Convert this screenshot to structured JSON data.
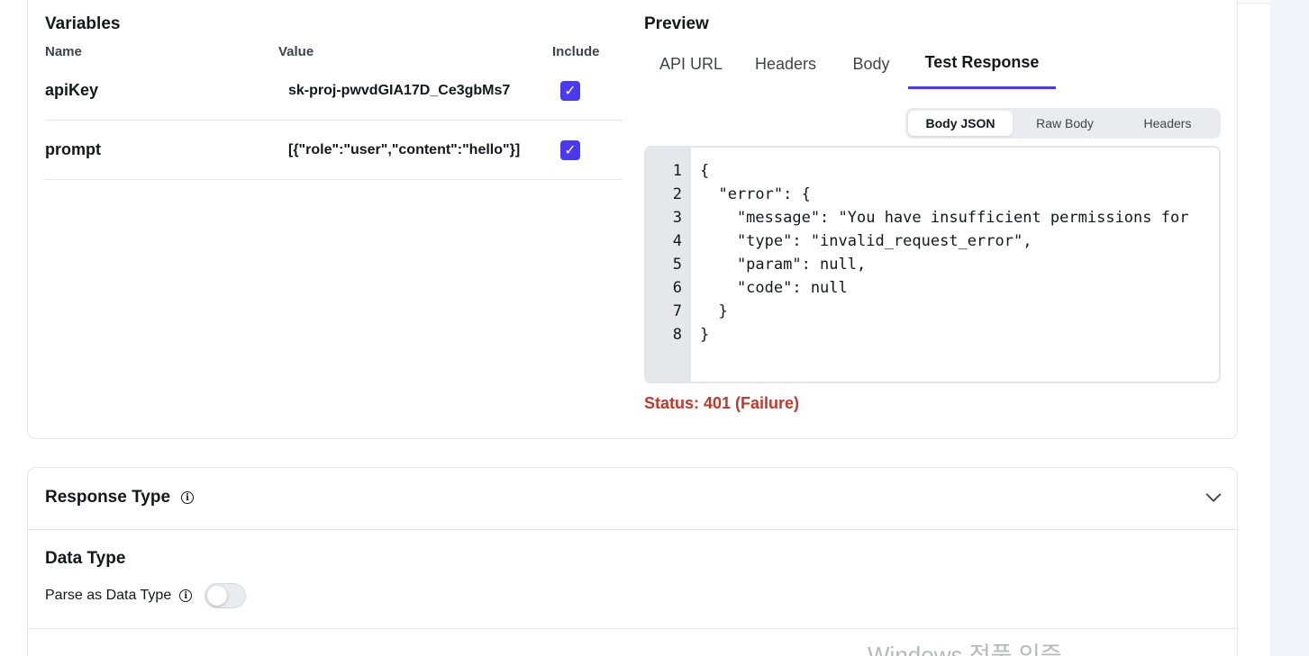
{
  "variables": {
    "title": "Variables",
    "columns": {
      "name": "Name",
      "value": "Value",
      "include": "Include"
    },
    "rows": [
      {
        "name": "apiKey",
        "value": "sk-proj-pwvdGIA17D_Ce3gbMs7",
        "include": true
      },
      {
        "name": "prompt",
        "value": "[{\"role\":\"user\",\"content\":\"hello\"}]",
        "include": true
      }
    ],
    "check_glyph": "✓"
  },
  "preview": {
    "title": "Preview",
    "tabs": [
      {
        "label": "API URL",
        "active": false
      },
      {
        "label": "Headers",
        "active": false
      },
      {
        "label": "Body",
        "active": false
      },
      {
        "label": "Test Response",
        "active": true
      }
    ],
    "subtabs": [
      {
        "label": "Body JSON",
        "active": true
      },
      {
        "label": "Raw Body",
        "active": false
      },
      {
        "label": "Headers",
        "active": false
      }
    ],
    "code_lines": [
      "{",
      "  \"error\": {",
      "    \"message\": \"You have insufficient permissions for",
      "    \"type\": \"invalid_request_error\",",
      "    \"param\": null,",
      "    \"code\": null",
      "  }",
      "}"
    ],
    "line_numbers": [
      "1",
      "2",
      "3",
      "4",
      "5",
      "6",
      "7",
      "8"
    ],
    "status": "Status:  401 (Failure)",
    "status_color": "#c0392b"
  },
  "response_type": {
    "title": "Response Type",
    "info_glyph": "i",
    "chevron": "chevron-down-icon"
  },
  "data_type": {
    "title": "Data Type",
    "parse_label": "Parse as Data Type",
    "info_glyph": "i",
    "toggle_on": false
  },
  "watermark": "Windows 정품 인증",
  "colors": {
    "accent": "#4b39ef",
    "failure": "#c0392b"
  }
}
